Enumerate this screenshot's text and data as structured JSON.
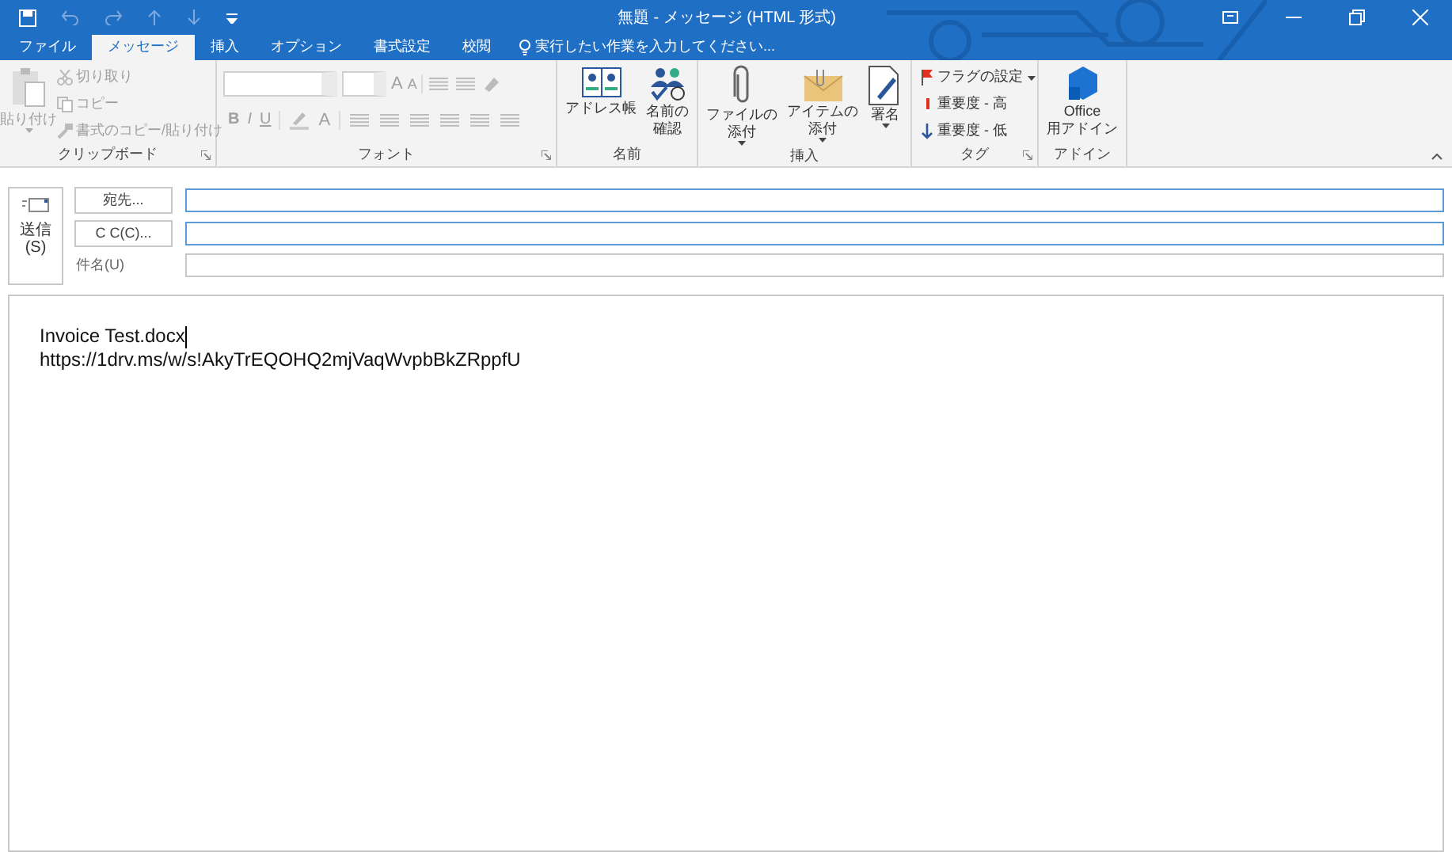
{
  "title_bar": {
    "title": "無題 - メッセージ (HTML 形式)"
  },
  "tabs": [
    {
      "label": "ファイル",
      "selected": false
    },
    {
      "label": "メッセージ",
      "selected": true
    },
    {
      "label": "挿入",
      "selected": false
    },
    {
      "label": "オプション",
      "selected": false
    },
    {
      "label": "書式設定",
      "selected": false
    },
    {
      "label": "校閲",
      "selected": false
    }
  ],
  "tell_me": {
    "placeholder": "実行したい作業を入力してください..."
  },
  "ribbon": {
    "groups": [
      {
        "label": "クリップボード",
        "disabled": true,
        "paste": "貼り付け",
        "small": [
          "切り取り",
          "コピー",
          "書式のコピー/貼り付け"
        ]
      },
      {
        "label": "フォント",
        "disabled": true,
        "grow": "A",
        "shrink": "A",
        "bold": "B",
        "italic": "I",
        "underline": "U",
        "color_glyph": "A"
      },
      {
        "label": "名前",
        "buttons": [
          {
            "lines": [
              "アドレス帳"
            ]
          },
          {
            "lines": [
              "名前の",
              "確認"
            ]
          }
        ]
      },
      {
        "label": "挿入",
        "buttons": [
          {
            "lines": [
              "ファイルの",
              "添付"
            ],
            "dropdown": true
          },
          {
            "lines": [
              "アイテムの",
              "添付"
            ],
            "dropdown": true
          },
          {
            "lines": [
              "署名"
            ],
            "dropdown": true
          }
        ]
      },
      {
        "label": "タグ",
        "small": [
          "フラグの設定",
          "重要度 - 高",
          "重要度 - 低"
        ]
      },
      {
        "label": "アドイン",
        "buttons": [
          {
            "lines": [
              "Office",
              "用アドイン"
            ]
          }
        ]
      }
    ]
  },
  "header": {
    "send": [
      "送信",
      "(S)"
    ],
    "to_button": "宛先...",
    "cc_button": "C C(C)...",
    "subject_label": "件名(U)"
  },
  "body": {
    "lines": [
      "Invoice Test.docx",
      "https://1drv.ms/w/s!AkyTrEQOHQ2mjVaqWvpbBkZRppfU"
    ]
  }
}
